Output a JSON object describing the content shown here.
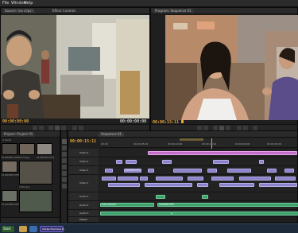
{
  "menu": {
    "items": [
      "File",
      "Window",
      "Help"
    ]
  },
  "source_monitor": {
    "tab_label": "Source: (no clips)",
    "tab_label_2": "Effect Controls",
    "timecode_in": "00:00:00:00",
    "timecode_dur": "00:00:00:00"
  },
  "program_monitor": {
    "tab_label": "Program: Sequence 01",
    "timecode_current": "00:00:15:11"
  },
  "project": {
    "tab_label": "Project: Project 01",
    "tab_label_2": "Media Browser",
    "item_count": "3 items",
    "clips": [
      {
        "name": "P1000981.MTS",
        "dur": "0:00:01"
      },
      {
        "name": "1370.jpg",
        "dur": "5:00"
      },
      {
        "name": "P1000963.MTS",
        "dur": "0:00:13"
      },
      {
        "name": "P1000983.MTS",
        "dur": "0:00:07"
      },
      {
        "name": "1361.jpg",
        "dur": "5:00"
      },
      {
        "name": "P1000966.MTS",
        "dur": "0:00:18"
      }
    ]
  },
  "timeline": {
    "tab_label": "Sequence 01",
    "timecode": "00:00:15:11",
    "ruler_labels": [
      "00:00",
      "00:00:05:00",
      "00:00:10:00",
      "00:00:15:00",
      "00:00:20:00",
      "00:00:25:00",
      "00:00:30:00"
    ],
    "tracks": [
      "Video 4",
      "Video 3",
      "Video 2",
      "Video 1",
      "Audio 1",
      "Audio 2",
      "Audio 3",
      "Master"
    ],
    "clip_labels": [
      "P1000983.MTS",
      "P1000966.MTS",
      "Cross Dissolve",
      "P1000963.MTS"
    ]
  },
  "taskbar": {
    "start_label": "Start",
    "app_label": "Adobe Premiere P..."
  },
  "colors": {
    "accent_orange": "#e8a33a",
    "video_clip": "#8a82c8",
    "pink_clip": "#c06ec7",
    "audio_clip": "#3ea06d"
  }
}
